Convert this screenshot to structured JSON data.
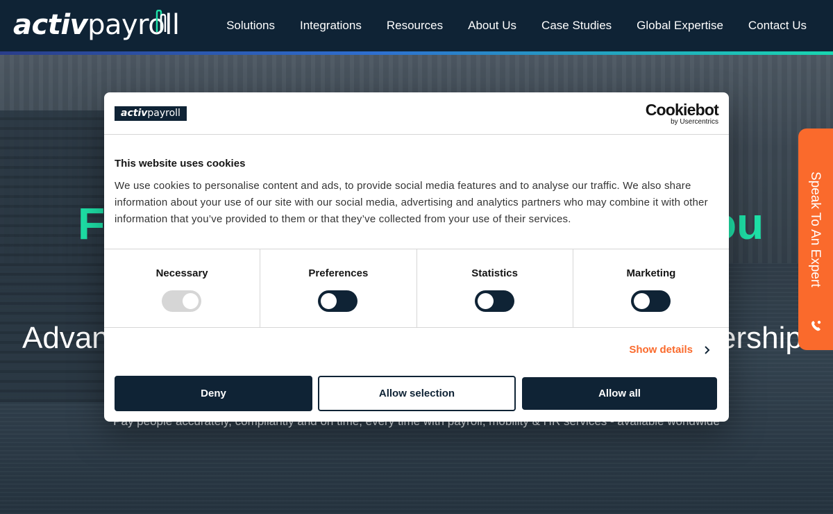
{
  "header": {
    "logo_bold": "activ",
    "logo_light": "payroll",
    "nav": [
      "Solutions",
      "Integrations",
      "Resources",
      "About Us",
      "Case Studies",
      "Global Expertise",
      "Contact Us"
    ]
  },
  "hero": {
    "title_left": "Fu",
    "title_right": "ou",
    "subtitle_left": "Advan",
    "subtitle_right": "ership",
    "tagline": "Pay people accurately, compliantly and on time, every time with payroll, mobility & HR services - available worldwide"
  },
  "side_tab": {
    "label": "Speak To An Expert"
  },
  "cookie_dialog": {
    "logo_bold": "activ",
    "logo_light": "payroll",
    "provider_name": "Cookiebot",
    "provider_by": "by Usercentrics",
    "title": "This website uses cookies",
    "body": "We use cookies to personalise content and ads, to provide social media features and to analyse our traffic. We also share information about your use of our site with our social media, advertising and analytics partners who may combine it with other information that you’ve provided to them or that they’ve collected from your use of their services.",
    "categories": [
      {
        "label": "Necessary",
        "enabled": true,
        "locked": true
      },
      {
        "label": "Preferences",
        "enabled": false,
        "locked": false
      },
      {
        "label": "Statistics",
        "enabled": false,
        "locked": false
      },
      {
        "label": "Marketing",
        "enabled": false,
        "locked": false
      }
    ],
    "show_details": "Show details",
    "buttons": {
      "deny": "Deny",
      "allow_selection": "Allow selection",
      "allow_all": "Allow all"
    }
  },
  "colors": {
    "navy": "#0f2335",
    "accent_orange": "#fa6a2c",
    "hero_green": "#1ee2a8"
  }
}
